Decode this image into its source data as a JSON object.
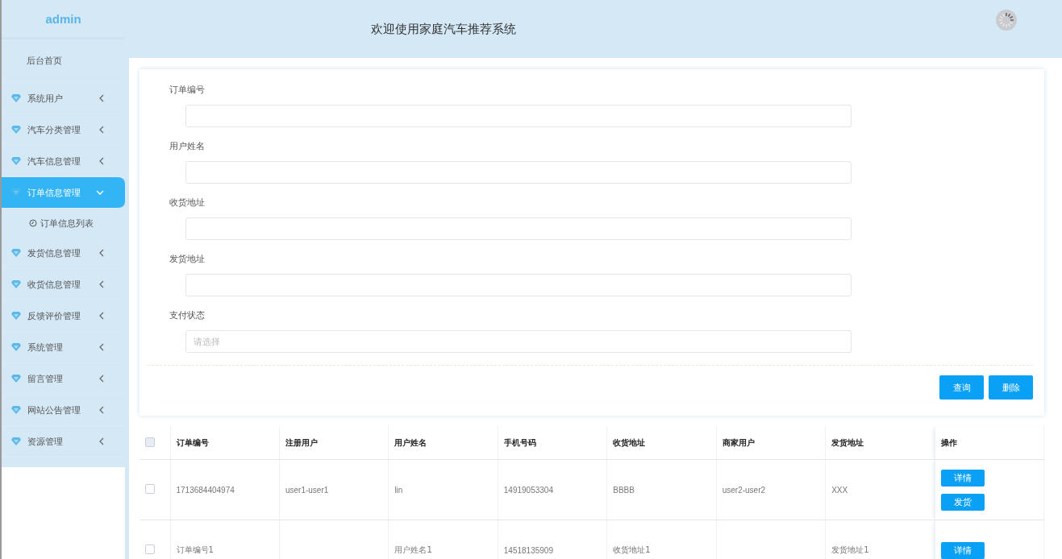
{
  "sidebar": {
    "brand": "admin",
    "items": [
      {
        "kind": "link",
        "label": "后台首页",
        "selected": false
      },
      {
        "kind": "menu",
        "label": "系统用户",
        "selected": false,
        "expanded": false
      },
      {
        "kind": "menu",
        "label": "汽车分类管理",
        "selected": false,
        "expanded": false
      },
      {
        "kind": "menu",
        "label": "汽车信息管理",
        "selected": false,
        "expanded": false
      },
      {
        "kind": "menu",
        "label": "订单信息管理",
        "selected": true,
        "expanded": true,
        "children": [
          {
            "label": "订单信息列表",
            "selected": false
          }
        ]
      },
      {
        "kind": "menu",
        "label": "发货信息管理",
        "selected": false,
        "expanded": false
      },
      {
        "kind": "menu",
        "label": "收货信息管理",
        "selected": false,
        "expanded": false
      },
      {
        "kind": "menu",
        "label": "反馈评价管理",
        "selected": false,
        "expanded": false
      },
      {
        "kind": "menu",
        "label": "系统管理",
        "selected": false,
        "expanded": false
      },
      {
        "kind": "menu",
        "label": "留言管理",
        "selected": false,
        "expanded": false
      },
      {
        "kind": "menu",
        "label": "网站公告管理",
        "selected": false,
        "expanded": false
      },
      {
        "kind": "menu",
        "label": "资源管理",
        "selected": false,
        "expanded": false
      }
    ]
  },
  "header": {
    "title": "欢迎使用家庭汽车推荐系统"
  },
  "search_form": {
    "fields": [
      {
        "kind": "text",
        "label": "订单编号"
      },
      {
        "kind": "text",
        "label": "用户姓名"
      },
      {
        "kind": "text",
        "label": "收货地址"
      },
      {
        "kind": "text",
        "label": "发货地址"
      },
      {
        "kind": "select",
        "label": "支付状态",
        "placeholder": "请选择"
      }
    ],
    "buttons": [
      "查询",
      "删除"
    ]
  },
  "table": {
    "all_checked": false,
    "columns": [
      "订单编号",
      "注册用户",
      "用户姓名",
      "手机号码",
      "收货地址",
      "商家用户",
      "发货地址",
      "操作"
    ],
    "rows": [
      {
        "checked": false,
        "cells": [
          "1713684404974",
          "user1-user1",
          "lin",
          "14919053304",
          "BBBB",
          "user2-user2",
          "XXX"
        ],
        "actions": [
          "详情",
          "发货"
        ]
      },
      {
        "checked": false,
        "cells": [
          "订单编号1",
          "",
          "用户姓名1",
          "14518135909",
          "收货地址1",
          "",
          "发货地址1"
        ],
        "actions": [
          "详情"
        ]
      }
    ]
  }
}
